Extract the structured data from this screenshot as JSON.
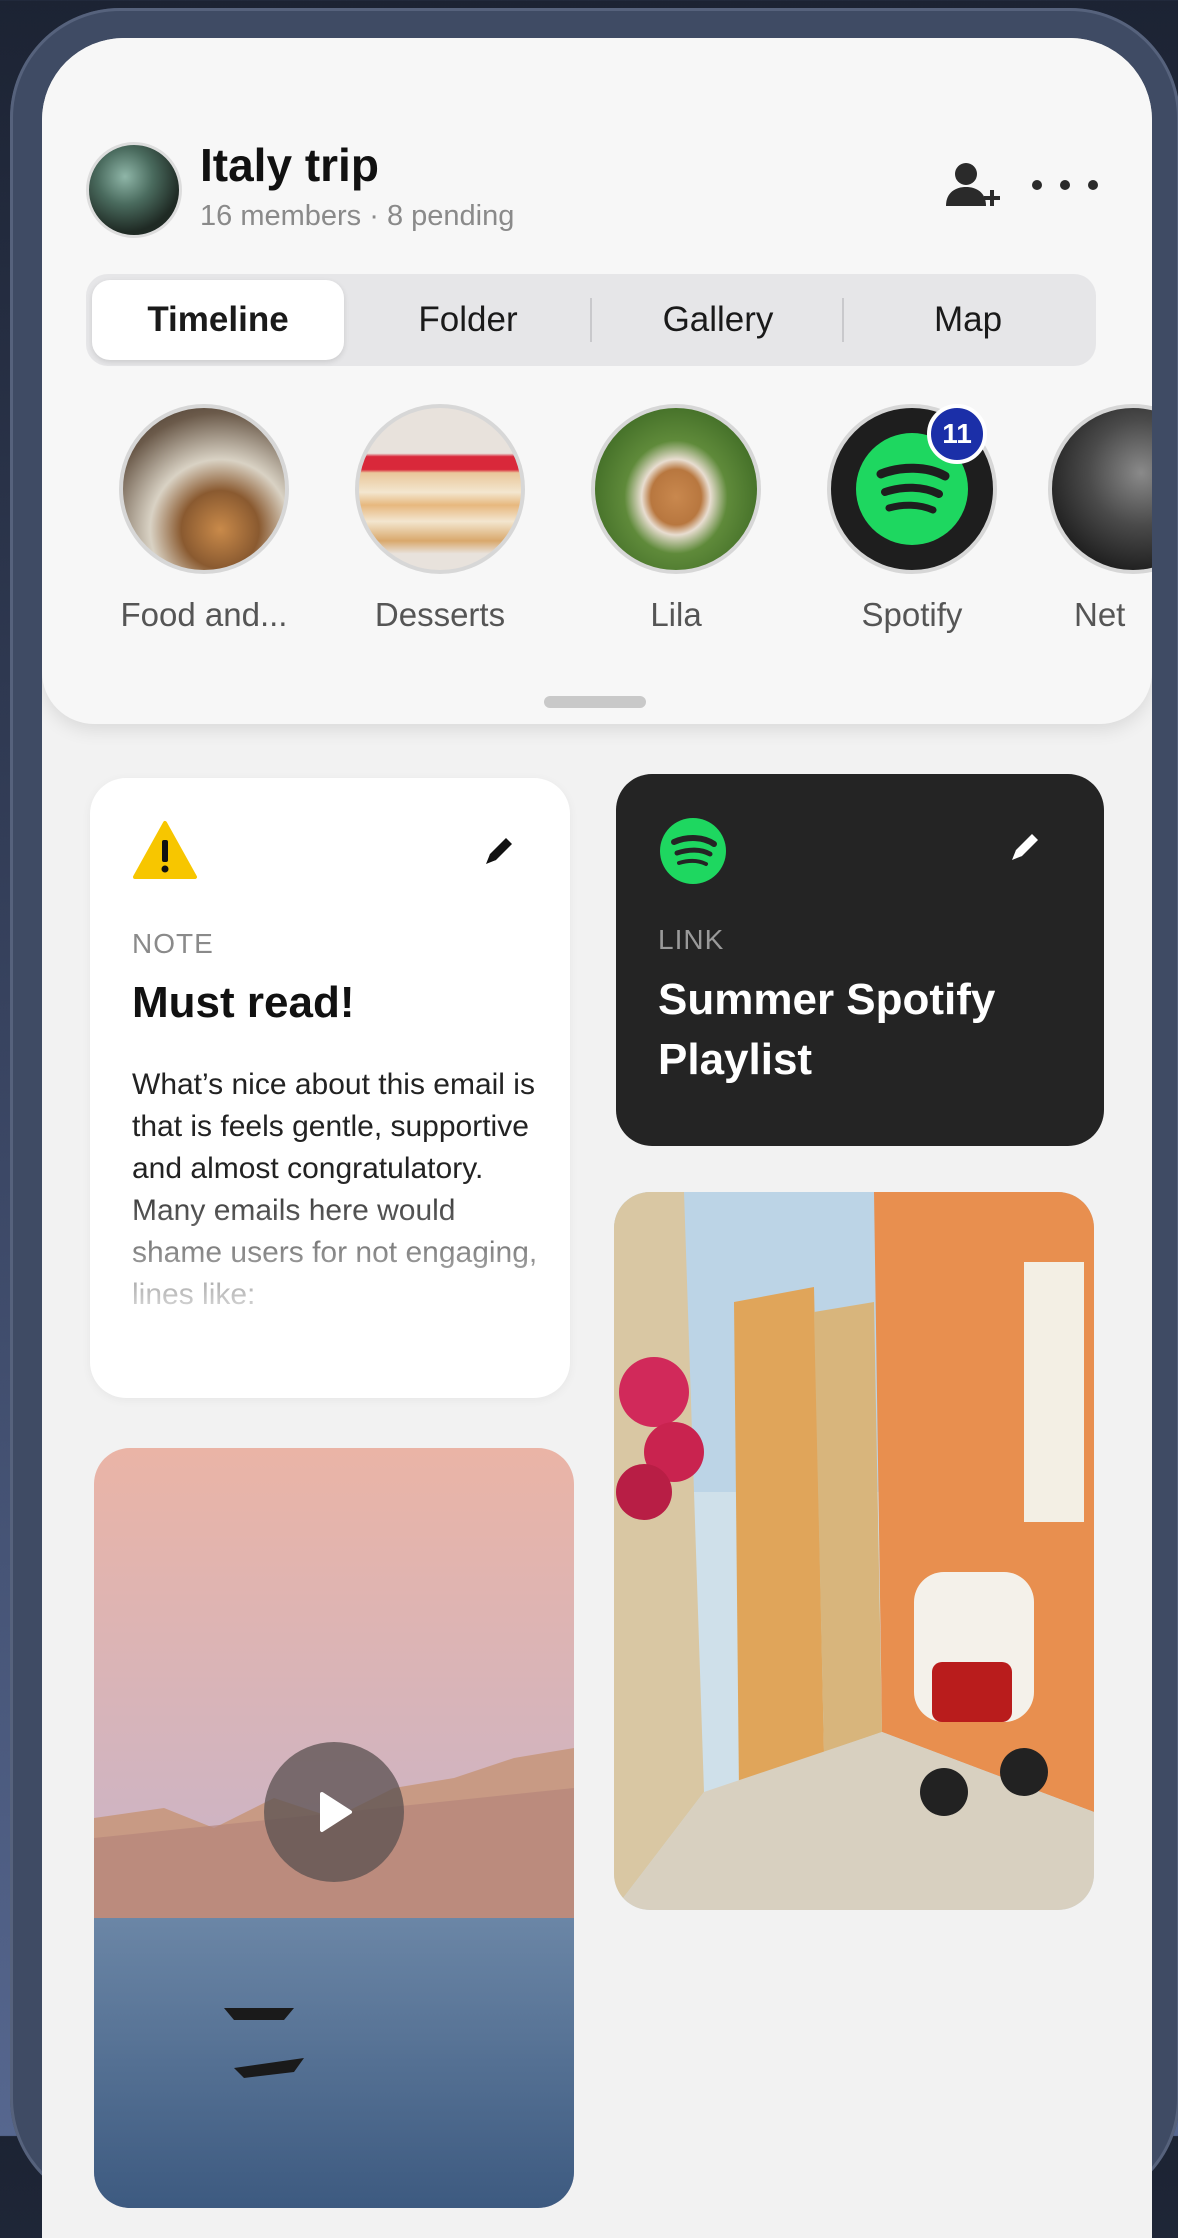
{
  "group": {
    "title": "Italy trip",
    "subtitle": "16 members · 8 pending"
  },
  "header_icons": [
    "add-member-icon",
    "more-icon"
  ],
  "tabs": [
    {
      "label": "Timeline",
      "active": true
    },
    {
      "label": "Folder",
      "active": false
    },
    {
      "label": "Gallery",
      "active": false
    },
    {
      "label": "Map",
      "active": false
    }
  ],
  "stories": [
    {
      "label": "Food and..."
    },
    {
      "label": "Desserts"
    },
    {
      "label": "Lila"
    },
    {
      "label": "Spotify",
      "badge": "11"
    },
    {
      "label": "Net"
    }
  ],
  "cards": {
    "note": {
      "type": "NOTE",
      "title": "Must read!",
      "body": "What’s nice about this email is that is feels gentle, supportive and almost congratulatory. Many emails here would shame users for not engaging, lines like:",
      "icon": "warning-icon"
    },
    "link": {
      "type": "LINK",
      "title": "Summer Spotify Playlist",
      "icon": "spotify-icon"
    }
  },
  "colors": {
    "spotify_green": "#1ed760",
    "badge_blue": "#1b2fa8",
    "warning_yellow": "#f7c600"
  }
}
